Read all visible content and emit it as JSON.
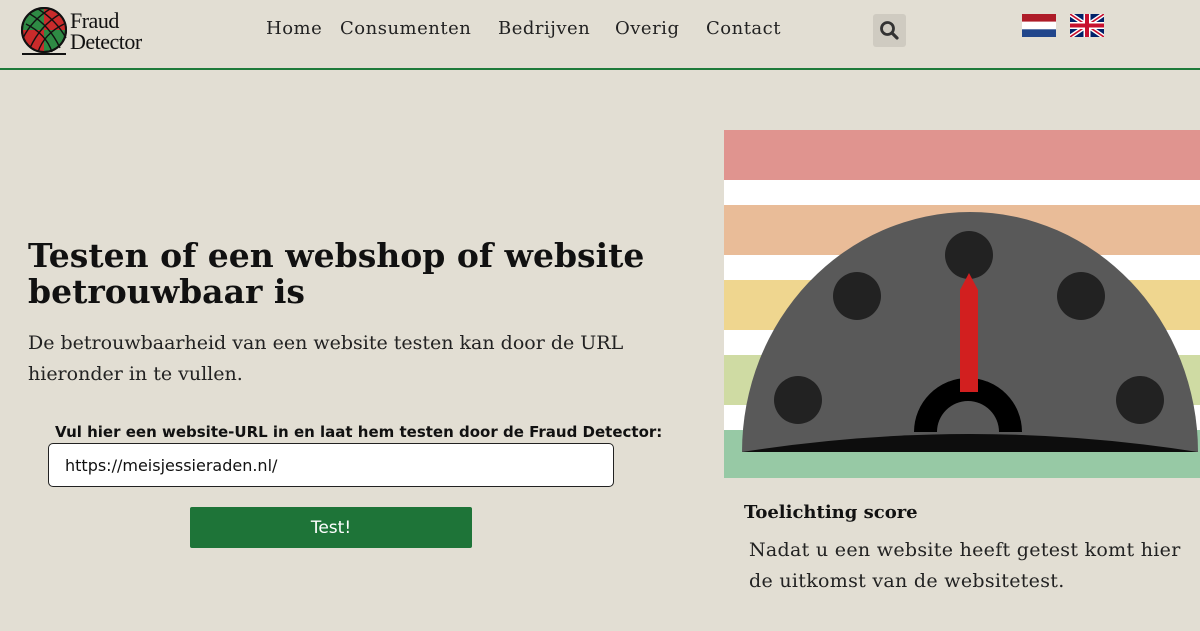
{
  "brand": {
    "line1": "Fraud",
    "line2": "Detector"
  },
  "nav": {
    "items": [
      {
        "label": "Home"
      },
      {
        "label": "Consumenten"
      },
      {
        "label": "Bedrijven"
      },
      {
        "label": "Overig"
      },
      {
        "label": "Contact"
      }
    ]
  },
  "icons": {
    "search": "search-icon",
    "flag_nl": "flag-netherlands-icon",
    "flag_uk": "flag-uk-icon"
  },
  "hero": {
    "title": "Testen of een webshop of website betrouwbaar is",
    "description": "De betrouwbaarheid van een website testen kan door de URL hieronder in te vullen."
  },
  "form": {
    "label": "Vul hier een website-URL in en laat hem testen door de Fraud Detector:",
    "url_value": "https://meisjessieraden.nl/",
    "submit_label": "Test!"
  },
  "score": {
    "title": "Toelichting score",
    "text": "Nadat u een website heeft getest komt hier de uitkomst van de websitetest."
  },
  "colors": {
    "accent_green": "#1e7438",
    "background": "#e2ded3",
    "band_red": "#e0948f",
    "band_orange": "#e9bc98",
    "band_yellow": "#efd68f",
    "band_lightgreen": "#cfdba3",
    "band_green": "#97c9a5",
    "needle_red": "#d21f1f"
  }
}
